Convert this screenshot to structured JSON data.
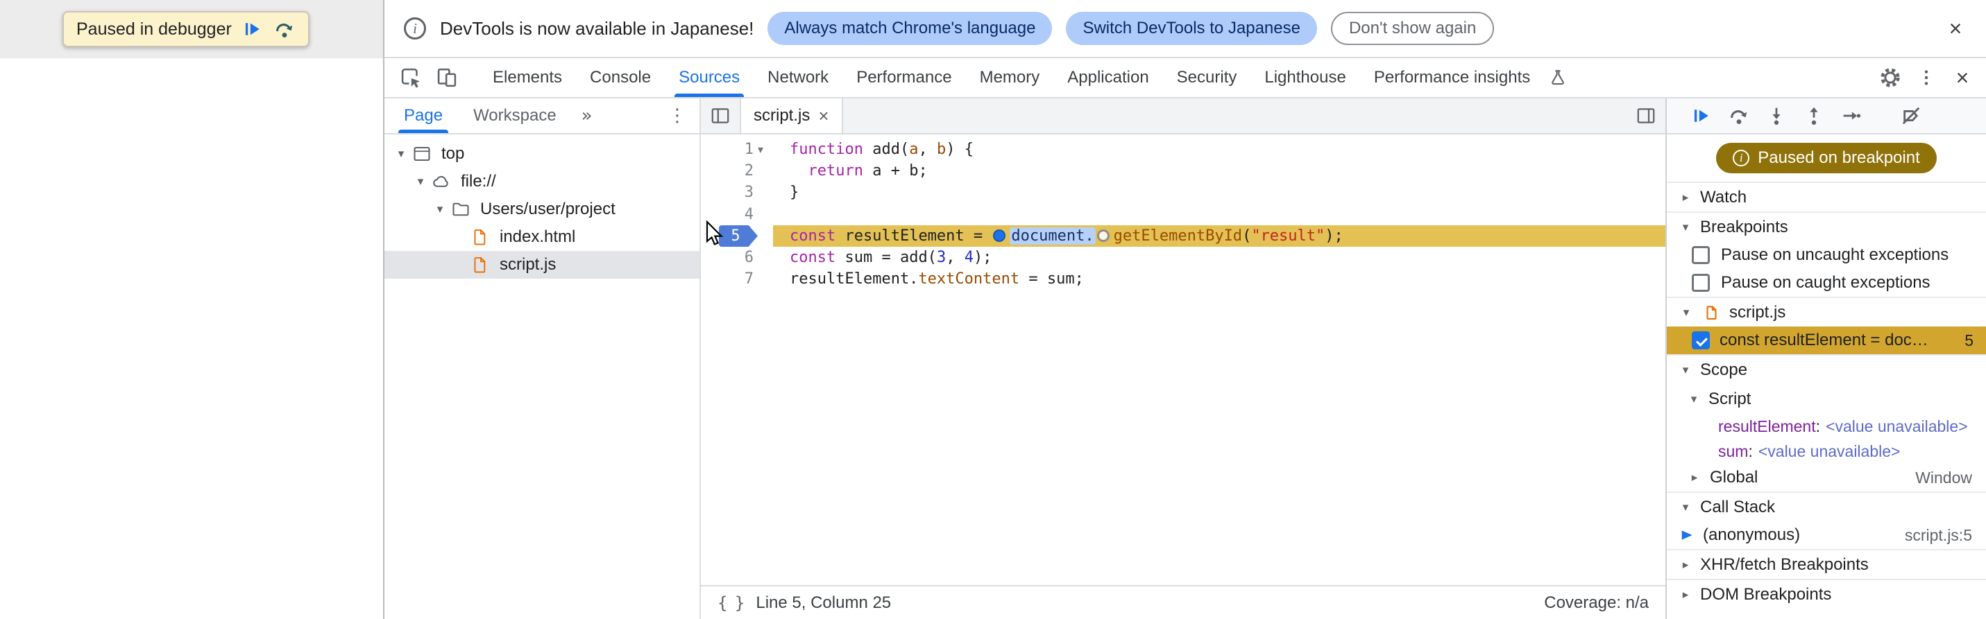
{
  "colors": {
    "accent_blue": "#1a73e8",
    "paused_line_bg": "#e3c155",
    "breakpoint_entry_bg": "#d2a62e",
    "paused_pill_bg": "#8f7209",
    "keyword": "#a625a6",
    "property": "#9a4a00",
    "string": "#c5221f",
    "number": "#1c2bcd"
  },
  "icons": {
    "expanded": "▾",
    "collapsed": "▸",
    "kebab": "⋮",
    "more_tabs": "»",
    "close": "×",
    "braces": "{ }",
    "info": "i"
  },
  "overlay": {
    "label": "Paused in debugger"
  },
  "infobar": {
    "message": "DevTools is now available in Japanese!",
    "action_primary": "Always match Chrome's language",
    "action_secondary": "Switch DevTools to Japanese",
    "action_dismiss": "Don't show again"
  },
  "tabs": {
    "items": [
      "Elements",
      "Console",
      "Sources",
      "Network",
      "Performance",
      "Memory",
      "Application",
      "Security",
      "Lighthouse",
      "Performance insights"
    ],
    "selected": "Sources"
  },
  "navigator": {
    "tab_page": "Page",
    "tab_workspace": "Workspace",
    "tree": [
      {
        "label": "top"
      },
      {
        "label": "file://"
      },
      {
        "label": "Users/user/project"
      },
      {
        "label": "index.html"
      },
      {
        "label": "script.js"
      }
    ]
  },
  "editor": {
    "tab_label": "script.js",
    "status_position": "Line 5, Column 25",
    "status_coverage": "Coverage: n/a",
    "code": {
      "paused_line": 5,
      "lines": [
        {
          "num": "1",
          "fold": "▾",
          "segs": [
            [
              "kw",
              "function"
            ],
            [
              "pl",
              " add("
            ],
            [
              "pr",
              "a"
            ],
            [
              "pl",
              ", "
            ],
            [
              "pr",
              "b"
            ],
            [
              "pl",
              ") {"
            ]
          ]
        },
        {
          "num": "2",
          "segs": [
            [
              "pl",
              "  "
            ],
            [
              "kw",
              "return"
            ],
            [
              "pl",
              " a + b;"
            ]
          ]
        },
        {
          "num": "3",
          "segs": [
            [
              "pl",
              "}"
            ]
          ]
        },
        {
          "num": "4",
          "segs": []
        },
        {
          "num": "5",
          "paused": true,
          "segs": [
            [
              "kw",
              "const"
            ],
            [
              "pl",
              " resultElement = "
            ],
            [
              "marker-blue",
              ""
            ],
            [
              "chip",
              "document."
            ],
            [
              "marker-gray",
              ""
            ],
            [
              "pr",
              "getElementById"
            ],
            [
              "pl",
              "("
            ],
            [
              "str",
              "\"result\""
            ],
            [
              "pl",
              ");"
            ]
          ]
        },
        {
          "num": "6",
          "segs": [
            [
              "kw",
              "const"
            ],
            [
              "pl",
              " sum = add("
            ],
            [
              "num",
              "3"
            ],
            [
              "pl",
              ", "
            ],
            [
              "num",
              "4"
            ],
            [
              "pl",
              ");"
            ]
          ]
        },
        {
          "num": "7",
          "segs": [
            [
              "pl",
              "resultElement."
            ],
            [
              "pr",
              "textContent"
            ],
            [
              "pl",
              " = sum;"
            ]
          ]
        }
      ]
    }
  },
  "debugger": {
    "paused_message": "Paused on breakpoint",
    "watch_label": "Watch",
    "breakpoints_label": "Breakpoints",
    "pause_uncaught": "Pause on uncaught exceptions",
    "pause_caught": "Pause on caught exceptions",
    "breakpoint_group": "script.js",
    "breakpoint_entry": {
      "label": "const resultElement = doc…",
      "line": "5",
      "checked": true
    },
    "scope_label": "Scope",
    "scope_script_label": "Script",
    "scope_vars": [
      {
        "name": "resultElement",
        "value": "<value unavailable>"
      },
      {
        "name": "sum",
        "value": "<value unavailable>"
      }
    ],
    "scope_global": {
      "label": "Global",
      "value": "Window"
    },
    "callstack_label": "Call Stack",
    "callstack_frame": {
      "name": "(anonymous)",
      "location": "script.js:5"
    },
    "xhr_label": "XHR/fetch Breakpoints",
    "dom_label": "DOM Breakpoints"
  }
}
